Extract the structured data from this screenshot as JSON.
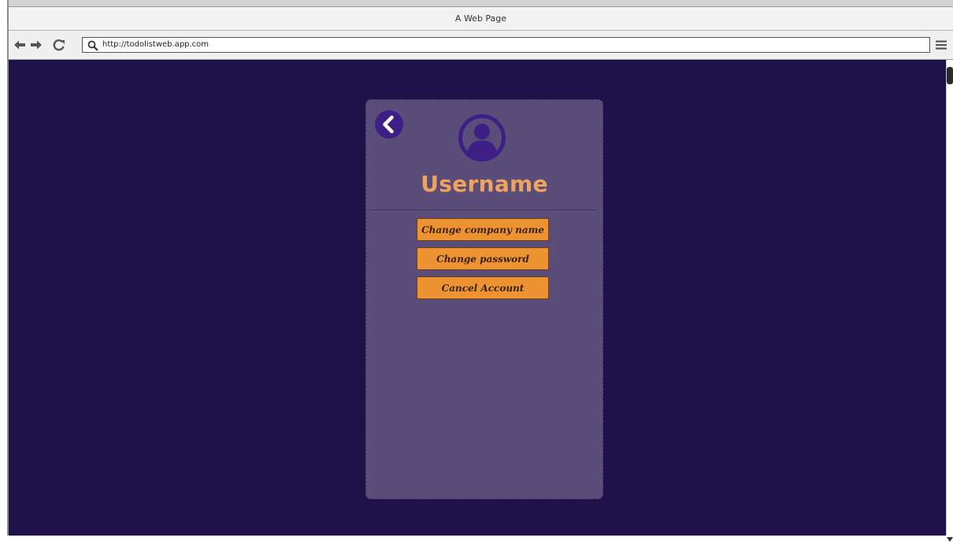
{
  "window": {
    "title": "A Web Page"
  },
  "navbar": {
    "url": "http://todolistweb.app.com"
  },
  "profile": {
    "username": "Username",
    "buttons": [
      {
        "label": "Change company name"
      },
      {
        "label": "Change password"
      },
      {
        "label": "Cancel Account"
      }
    ]
  },
  "icons": {
    "back": "chevron-left-circle-icon",
    "avatar": "user-circle-icon",
    "nav_back": "arrow-left-icon",
    "nav_forward": "arrow-right-icon",
    "refresh": "refresh-icon",
    "search": "search-icon",
    "menu": "hamburger-menu-icon"
  },
  "colors": {
    "page_background": "#1f114a",
    "card_background": "#5a4d7a",
    "accent_text": "#f0a35a",
    "button_background": "#ee9331",
    "icon_color": "#3e1f86"
  }
}
